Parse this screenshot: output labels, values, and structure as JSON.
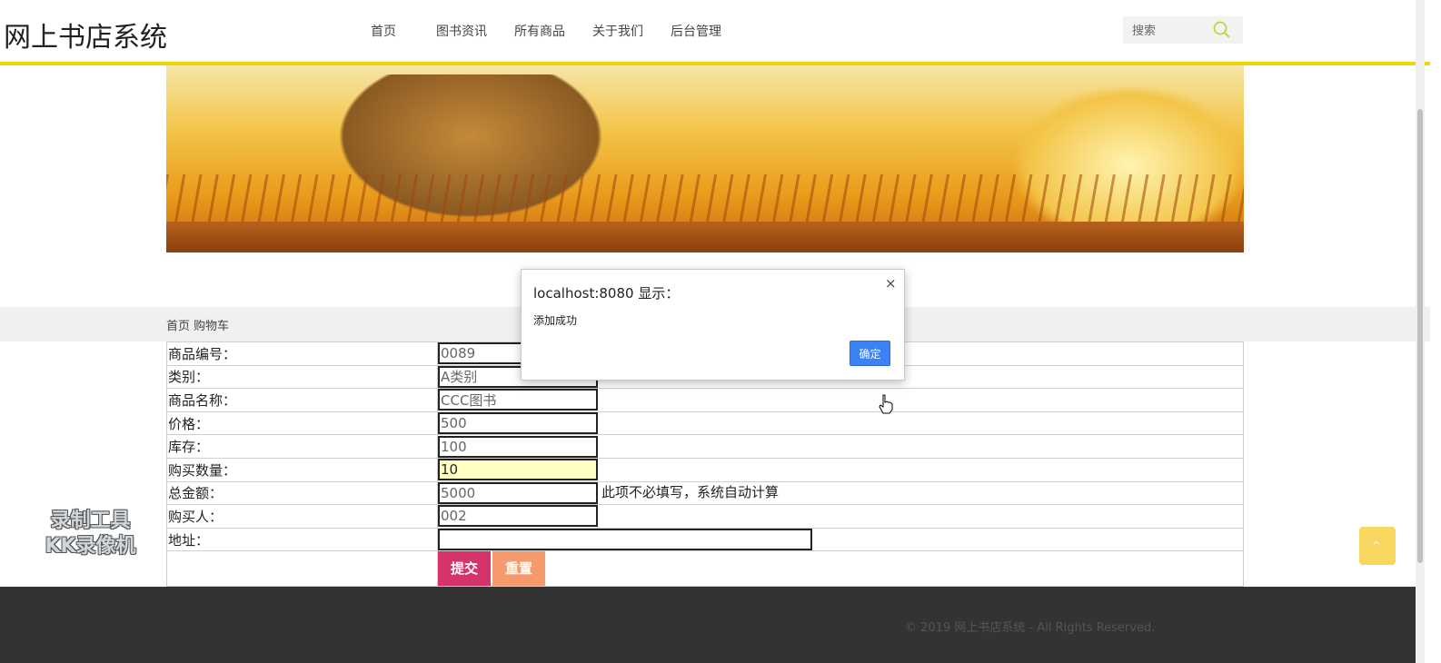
{
  "header": {
    "site_title": "网上书店系统",
    "nav": [
      "首页",
      "图书资讯",
      "所有商品",
      "关于我们",
      "后台管理"
    ],
    "search_placeholder": "搜索",
    "search_icon": "search-icon",
    "accent_color": "#f2d500"
  },
  "breadcrumb": {
    "home": "首页",
    "current": "购物车"
  },
  "form": {
    "rows": [
      {
        "label": "商品编号：",
        "value": "0089"
      },
      {
        "label": "类别：",
        "value": "A类别"
      },
      {
        "label": "商品名称：",
        "value": "CCC图书"
      },
      {
        "label": "价格：",
        "value": "500"
      },
      {
        "label": "库存：",
        "value": "100"
      },
      {
        "label": "购买数量：",
        "value": "10"
      },
      {
        "label": "总金额：",
        "value": "5000",
        "hint": "此项不必填写，系统自动计算"
      },
      {
        "label": "购买人：",
        "value": "002"
      },
      {
        "label": "地址：",
        "value": ""
      }
    ],
    "submit_label": "提交",
    "reset_label": "重置"
  },
  "dialog": {
    "title": "localhost:8080 显示：",
    "message": "添加成功",
    "ok_label": "确定",
    "close_glyph": "×"
  },
  "watermark": {
    "line1": "录制工具",
    "line2": "KK录像机"
  },
  "footer": {
    "copyright": "© 2019 网上书店系统 - All Rights Reserved."
  },
  "back_to_top": {
    "glyph": "^"
  }
}
